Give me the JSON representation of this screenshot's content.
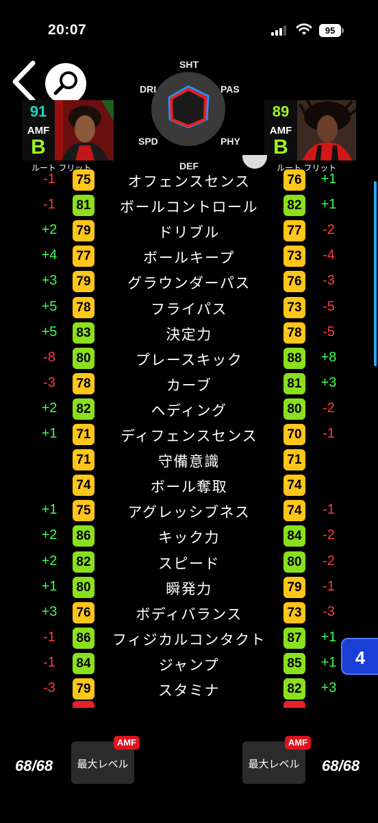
{
  "status": {
    "time": "20:07",
    "battery": "95"
  },
  "radar": {
    "labels": {
      "sht": "SHT",
      "pas": "PAS",
      "phy": "PHY",
      "def": "DEF",
      "spd": "SPD",
      "dri": "DRI"
    }
  },
  "players": {
    "left": {
      "rating": "91",
      "position": "AMF",
      "grade": "B",
      "name": "ルート フリット",
      "rating_color": "#1fd8c4",
      "level": "68/68",
      "max_level_label": "最大レベル",
      "tag": "AMF"
    },
    "right": {
      "rating": "89",
      "position": "AMF",
      "grade": "B",
      "name": "ルート フリット",
      "rating_color": "#9cf51f",
      "level": "68/68",
      "max_level_label": "最大レベル",
      "tag": "AMF"
    }
  },
  "colors": {
    "green_box": "#8be01e",
    "yellow_box": "#ffc61a",
    "positive": "#3cff4f",
    "negative": "#ff3b3b"
  },
  "stats": [
    {
      "name": "オフェンスセンス",
      "left": "75",
      "right": "76",
      "left_diff": "-1",
      "right_diff": "+1",
      "left_color": "yellow",
      "right_color": "yellow"
    },
    {
      "name": "ボールコントロール",
      "left": "81",
      "right": "82",
      "left_diff": "-1",
      "right_diff": "+1",
      "left_color": "green",
      "right_color": "green"
    },
    {
      "name": "ドリブル",
      "left": "79",
      "right": "77",
      "left_diff": "+2",
      "right_diff": "-2",
      "left_color": "yellow",
      "right_color": "yellow"
    },
    {
      "name": "ボールキープ",
      "left": "77",
      "right": "73",
      "left_diff": "+4",
      "right_diff": "-4",
      "left_color": "yellow",
      "right_color": "yellow"
    },
    {
      "name": "グラウンダーパス",
      "left": "79",
      "right": "76",
      "left_diff": "+3",
      "right_diff": "-3",
      "left_color": "yellow",
      "right_color": "yellow"
    },
    {
      "name": "フライパス",
      "left": "78",
      "right": "73",
      "left_diff": "+5",
      "right_diff": "-5",
      "left_color": "yellow",
      "right_color": "yellow"
    },
    {
      "name": "決定力",
      "left": "83",
      "right": "78",
      "left_diff": "+5",
      "right_diff": "-5",
      "left_color": "green",
      "right_color": "yellow"
    },
    {
      "name": "プレースキック",
      "left": "80",
      "right": "88",
      "left_diff": "-8",
      "right_diff": "+8",
      "left_color": "green",
      "right_color": "green"
    },
    {
      "name": "カーブ",
      "left": "78",
      "right": "81",
      "left_diff": "-3",
      "right_diff": "+3",
      "left_color": "yellow",
      "right_color": "green"
    },
    {
      "name": "ヘディング",
      "left": "82",
      "right": "80",
      "left_diff": "+2",
      "right_diff": "-2",
      "left_color": "green",
      "right_color": "green"
    },
    {
      "name": "ディフェンスセンス",
      "left": "71",
      "right": "70",
      "left_diff": "+1",
      "right_diff": "-1",
      "left_color": "yellow",
      "right_color": "yellow"
    },
    {
      "name": "守備意識",
      "left": "71",
      "right": "71",
      "left_diff": "",
      "right_diff": "",
      "left_color": "yellow",
      "right_color": "yellow"
    },
    {
      "name": "ボール奪取",
      "left": "74",
      "right": "74",
      "left_diff": "",
      "right_diff": "",
      "left_color": "yellow",
      "right_color": "yellow"
    },
    {
      "name": "アグレッシブネス",
      "left": "75",
      "right": "74",
      "left_diff": "+1",
      "right_diff": "-1",
      "left_color": "yellow",
      "right_color": "yellow"
    },
    {
      "name": "キック力",
      "left": "86",
      "right": "84",
      "left_diff": "+2",
      "right_diff": "-2",
      "left_color": "green",
      "right_color": "green"
    },
    {
      "name": "スピード",
      "left": "82",
      "right": "80",
      "left_diff": "+2",
      "right_diff": "-2",
      "left_color": "green",
      "right_color": "green"
    },
    {
      "name": "瞬発力",
      "left": "80",
      "right": "79",
      "left_diff": "+1",
      "right_diff": "-1",
      "left_color": "green",
      "right_color": "yellow"
    },
    {
      "name": "ボディバランス",
      "left": "76",
      "right": "73",
      "left_diff": "+3",
      "right_diff": "-3",
      "left_color": "yellow",
      "right_color": "yellow"
    },
    {
      "name": "フィジカルコンタクト",
      "left": "86",
      "right": "87",
      "left_diff": "-1",
      "right_diff": "+1",
      "left_color": "green",
      "right_color": "green"
    },
    {
      "name": "ジャンプ",
      "left": "84",
      "right": "85",
      "left_diff": "-1",
      "right_diff": "+1",
      "left_color": "green",
      "right_color": "green"
    },
    {
      "name": "スタミナ",
      "left": "79",
      "right": "82",
      "left_diff": "-3",
      "right_diff": "+3",
      "left_color": "yellow",
      "right_color": "green"
    }
  ],
  "page_badge": "4"
}
